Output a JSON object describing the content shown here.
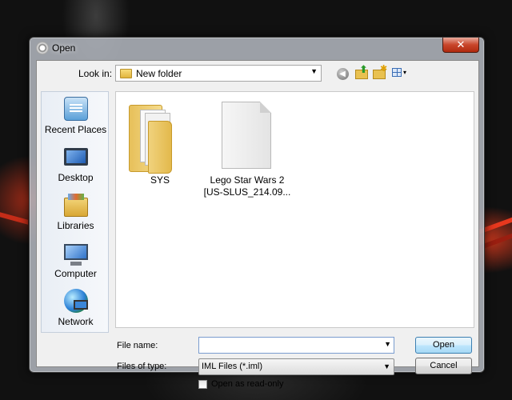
{
  "window": {
    "title": "Open",
    "close_glyph": "✕"
  },
  "toolbar": {
    "look_in_label": "Look in:",
    "look_in_value": "New folder",
    "dropdown_glyph": "▼",
    "back_glyph": "◀",
    "up_glyph": "⬆",
    "new_glyph": "✱",
    "view_glyph": "▾"
  },
  "places": [
    {
      "label": "Recent Places",
      "icon": "recent-places-icon"
    },
    {
      "label": "Desktop",
      "icon": "desktop-icon"
    },
    {
      "label": "Libraries",
      "icon": "libraries-icon"
    },
    {
      "label": "Computer",
      "icon": "computer-icon"
    },
    {
      "label": "Network",
      "icon": "network-icon"
    }
  ],
  "files": [
    {
      "name": "SYS",
      "type": "folder"
    },
    {
      "name_line1": "Lego Star Wars 2",
      "name_line2": "[US-SLUS_214.09...",
      "type": "file"
    }
  ],
  "form": {
    "file_name_label": "File name:",
    "file_name_value": "",
    "files_of_type_label": "Files of type:",
    "files_of_type_value": "IML Files (*.iml)",
    "read_only_label": "Open as read-only"
  },
  "buttons": {
    "open": "Open",
    "cancel": "Cancel"
  }
}
